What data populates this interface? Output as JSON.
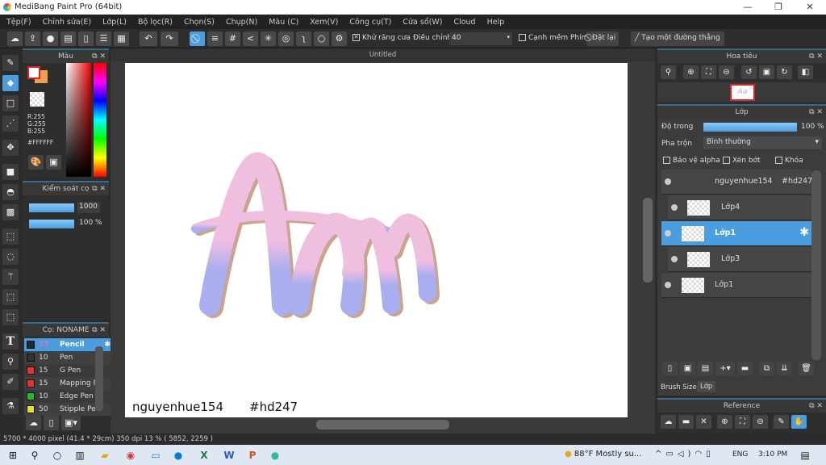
{
  "window": {
    "title": "MediBang Paint Pro (64bit)",
    "minimize": "—",
    "maximize": "❐",
    "close": "✕"
  },
  "menu": [
    "Tệp(F)",
    "Chỉnh sửa(E)",
    "Lớp(L)",
    "Bộ lọc(R)",
    "Chọn(S)",
    "Chụp(N)",
    "Màu (C)",
    "Xem(V)",
    "Công cụ(T)",
    "Cửa sổ(W)",
    "Cloud",
    "Help"
  ],
  "toolbar": {
    "antialias": "Khử răng cưa",
    "adjust_label": "Điều chỉnh",
    "adjust_value": "40",
    "soft_edge": "Cạnh mềm",
    "key_label": "Phím",
    "reset": "Đặt lại",
    "make_line": "Tạo một đường thẳng"
  },
  "color_panel": {
    "title": "Màu",
    "r": "R:255",
    "g": "G:255",
    "b": "B:255",
    "hex": "#FFFFFF",
    "primary": "#ffffff",
    "secondary": "#f0a050"
  },
  "brush_control": {
    "title": "Kiểm soát cọ",
    "size": "1000",
    "opacity": "100 %"
  },
  "brush_panel": {
    "title": "Cọ: NONAME",
    "items": [
      {
        "size": "13",
        "name": "Pencil",
        "color": "#1e2a36",
        "selected": true
      },
      {
        "size": "10",
        "name": "Pen",
        "color": "#333333"
      },
      {
        "size": "15",
        "name": "G Pen",
        "color": "#e83030"
      },
      {
        "size": "15",
        "name": "Mapping P",
        "color": "#e83030"
      },
      {
        "size": "10",
        "name": "Edge Pen",
        "color": "#22bb22"
      },
      {
        "size": "50",
        "name": "Stipple Pe",
        "color": "#e8e020"
      }
    ]
  },
  "canvas": {
    "tab": "Untitled",
    "signature_name": "nguyenhue154",
    "signature_tag": "#hd247"
  },
  "navigator": {
    "title": "Hoa tiêu"
  },
  "layers": {
    "title": "Lớp",
    "opacity_label": "Độ trong",
    "opacity_value": "100 %",
    "opacity": 100,
    "blend_label": "Pha trộn",
    "blend_value": "Bình thường",
    "protect_alpha": "Bảo vệ alpha",
    "clipping": "Xén bớt",
    "lock": "Khóa",
    "items": [
      {
        "name": "nguyenhue154",
        "extra": "#hd247"
      },
      {
        "name": "Lớp4"
      },
      {
        "name": "Lớp1",
        "selected": true
      },
      {
        "name": "Lớp3"
      },
      {
        "name": "Lớp1"
      }
    ],
    "tabs": [
      "Brush Size",
      "Lớp"
    ]
  },
  "reference": {
    "title": "Reference"
  },
  "status": "5700 * 4000 pixel   (41.4 * 29cm)   350 dpi   13 %   ( 5852, 2259 )",
  "taskbar": {
    "weather": "88°F  Mostly su...",
    "lang": "ENG",
    "time": "3:10 PM"
  }
}
